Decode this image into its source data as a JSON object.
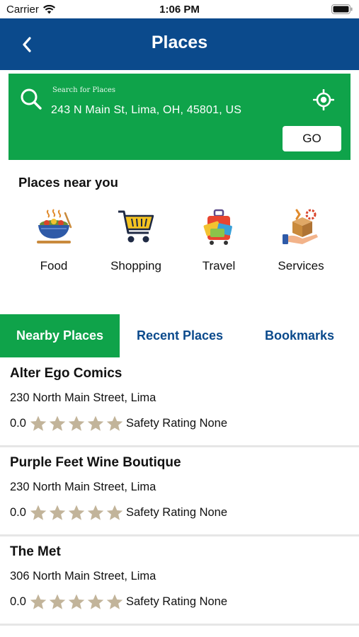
{
  "status_bar": {
    "carrier": "Carrier",
    "time": "1:06 PM"
  },
  "nav": {
    "title": "Places"
  },
  "search": {
    "caption": "Search for Places",
    "value": "243 N Main St, Lima, OH, 45801, US",
    "go_label": "GO"
  },
  "near": {
    "title": "Places near you",
    "categories": [
      {
        "label": "Food",
        "icon": "food-bowl-icon"
      },
      {
        "label": "Shopping",
        "icon": "shopping-cart-icon"
      },
      {
        "label": "Travel",
        "icon": "luggage-icon"
      },
      {
        "label": "Services",
        "icon": "service-box-icon"
      }
    ]
  },
  "tabs": [
    {
      "label": "Nearby Places",
      "active": true
    },
    {
      "label": "Recent Places",
      "active": false
    },
    {
      "label": "Bookmarks",
      "active": false
    }
  ],
  "places": [
    {
      "name": "Alter Ego Comics",
      "address": "230 North Main Street, Lima",
      "rating": "0.0",
      "stars": 5,
      "safety": "Safety Rating None"
    },
    {
      "name": "Purple Feet Wine Boutique",
      "address": "230 North Main Street, Lima",
      "rating": "0.0",
      "stars": 5,
      "safety": "Safety Rating None"
    },
    {
      "name": "The Met",
      "address": "306 North Main Street, Lima",
      "rating": "0.0",
      "stars": 5,
      "safety": "Safety Rating None"
    }
  ],
  "colors": {
    "nav_blue": "#0b4a8c",
    "brand_green": "#0fa34a",
    "star_tan": "#c2b49a"
  }
}
